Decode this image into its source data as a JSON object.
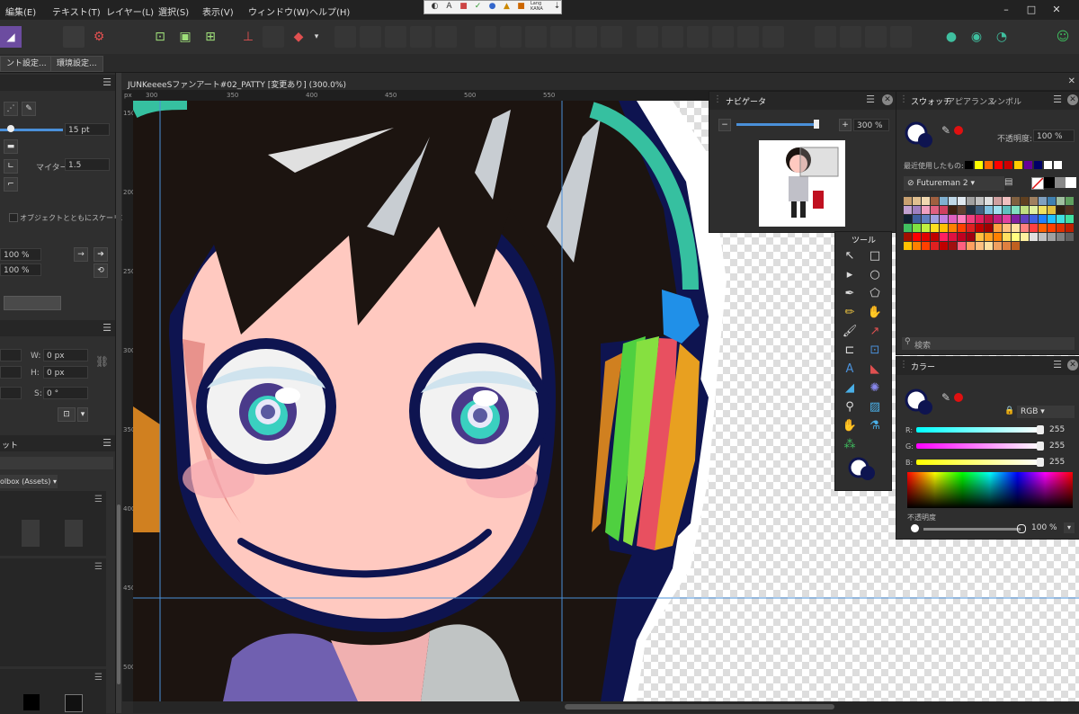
{
  "menu": [
    "編集(E)",
    "テキスト(T)",
    "レイヤー(L)",
    "選択(S)",
    "表示(V)",
    "ウィンドウ(W)",
    "ヘルプ(H)"
  ],
  "window_controls": [
    "–",
    "□",
    "✕"
  ],
  "float_toolbar_label": "Lang KANA",
  "row2_buttons": [
    "ント設定...",
    "環境設定..."
  ],
  "left_panel": {
    "width_value": "15 pt",
    "miter_label": "マイター:",
    "miter_value": "1.5",
    "scale_checkbox": "オブジェクトとともにスケーリング",
    "pct1": "100 %",
    "pct2": "100 %",
    "w_label": "W:",
    "w_value": "0 px",
    "h_label": "H:",
    "h_value": "0 px",
    "s_label": "S:",
    "s_value": "0 °",
    "assets_tab": "ット",
    "assets_select": "olbox (Assets)"
  },
  "document": {
    "title": "JUNKeeeeSファンアート#02_PATTY [変更あり] (300.0%)"
  },
  "ruler": {
    "h_unit": "px",
    "h_ticks": [
      "300",
      "350",
      "400",
      "450",
      "500",
      "550"
    ],
    "v_ticks": [
      "150",
      "200",
      "250",
      "300",
      "350",
      "400",
      "450",
      "500"
    ]
  },
  "navigator": {
    "tab": "ナビゲータ",
    "zoom": "300 %"
  },
  "tools": {
    "title": "ツール"
  },
  "swatches": {
    "tabs": [
      "スウォッチ",
      "アピアランス",
      "シンボル"
    ],
    "opacity_label": "不透明度:",
    "opacity_value": "100 %",
    "recent_label": "最近使用したもの:",
    "palette_name": "Futureman 2",
    "search_placeholder": "検索",
    "recent_colors": [
      "#000000",
      "#ffff00",
      "#ff6a00",
      "#ff0000",
      "#cc0000",
      "#ffcc00",
      "#660099",
      "#000066",
      "#ffffff",
      "#ffffff"
    ]
  },
  "color": {
    "tab": "カラー",
    "model": "RGB",
    "r_label": "R:",
    "g_label": "G:",
    "b_label": "B:",
    "r_value": "255",
    "g_value": "255",
    "b_value": "255",
    "opacity_label": "不透明度",
    "opacity_value": "100 %"
  },
  "colors": {
    "accent_blue": "#4a90d9",
    "user_green": "#3fbf5f"
  }
}
